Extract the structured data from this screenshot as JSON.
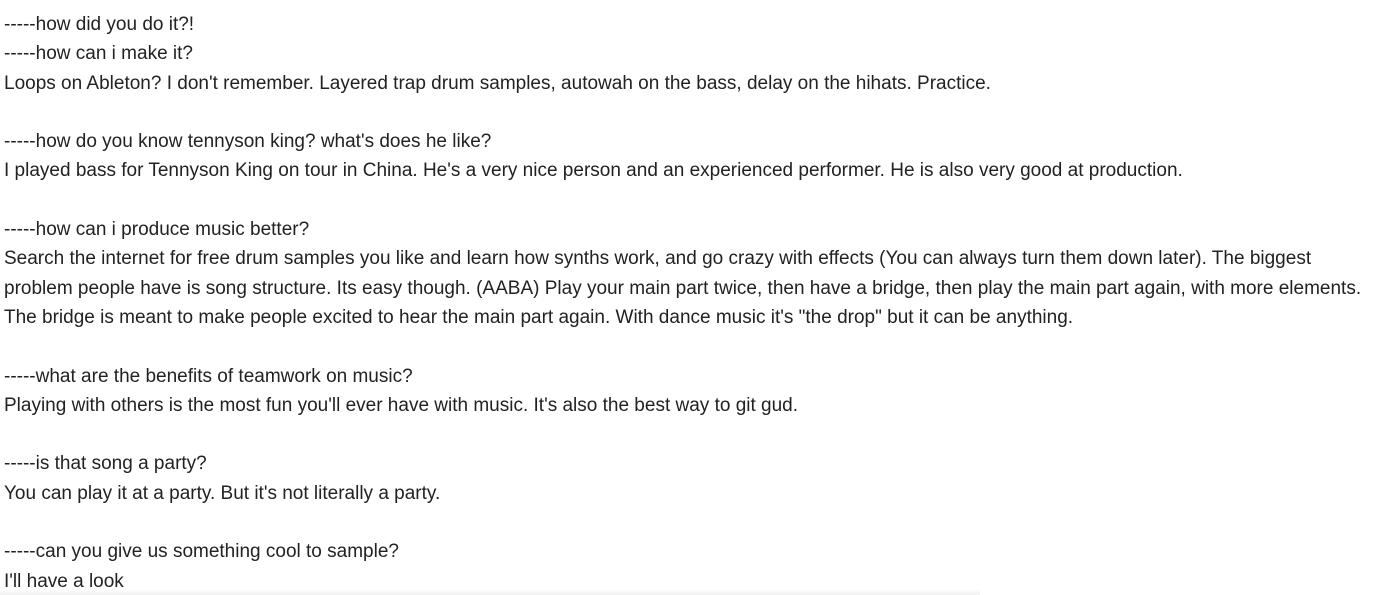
{
  "qa": [
    {
      "questions": [
        "-----how did you do it?!",
        "-----how can i make it?"
      ],
      "answer_lines": [
        "Loops on Ableton? I don't remember. Layered trap drum samples, autowah on the bass, delay on the hihats. Practice."
      ]
    },
    {
      "questions": [
        "-----how do you know tennyson king? what's does he like?"
      ],
      "answer_lines": [
        "I played bass for Tennyson King on tour in China. He's a very nice person and an experienced performer. He is also very good at production."
      ]
    },
    {
      "questions": [
        "-----how can i produce music better?"
      ],
      "answer_lines": [
        "Search the internet for free drum samples you like and learn how synths work, and go crazy with effects (You can always turn them down later). The biggest",
        "problem people have is song structure. Its easy though. (AABA) Play your main part twice, then have a bridge, then play the main part again, with more elements.",
        "The bridge is meant to make people excited to hear the main part again. With dance music it's \"the drop\" but it can be anything."
      ]
    },
    {
      "questions": [
        "-----what are the benefits of teamwork on music?"
      ],
      "answer_lines": [
        "Playing with others is the most fun you'll ever have with music. It's also the best way to git gud."
      ]
    },
    {
      "questions": [
        "-----is that song a party?"
      ],
      "answer_lines": [
        "You can play it at a party. But it's not literally a party."
      ]
    },
    {
      "questions": [
        "-----can you give us something cool to sample?"
      ],
      "answer_lines": [
        "I'll have a look"
      ]
    }
  ]
}
